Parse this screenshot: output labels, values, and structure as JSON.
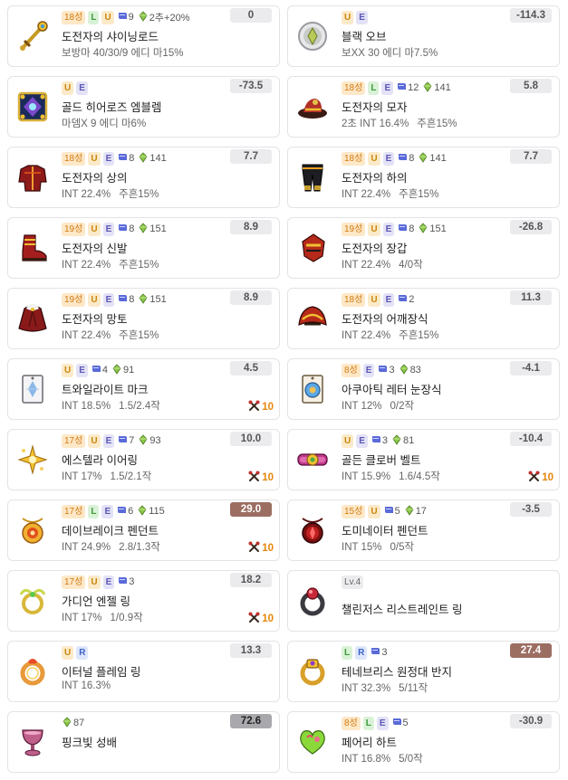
{
  "colors": {
    "star_bg": "#fde8c8",
    "star_text": "#d27a10",
    "L": "#3f9a3a",
    "U": "#c9860a",
    "E": "#5b56b6",
    "R": "#3d63c8",
    "score_bg": "#ebebee",
    "score_brown": "#9c6e62",
    "score_gray": "#a9a9ad",
    "lucky": "#e6860a"
  },
  "items": [
    {
      "col": 0,
      "row": 0,
      "icon": "shining-rod-icon",
      "star": "18성",
      "L": "L",
      "U": "U",
      "scroll": "9",
      "gem": "2추+20%",
      "name": "도전자의 샤이닝로드",
      "stats": [
        "보방마 40/30/9 에디 마15%"
      ],
      "score": "0",
      "hl": ""
    },
    {
      "col": 1,
      "row": 0,
      "icon": "black-orb-icon",
      "U": "U",
      "E": "E",
      "name": "블랙 오브",
      "stats": [
        "보XX 30 에디 마7.5%"
      ],
      "score": "-114.3",
      "hl": ""
    },
    {
      "col": 0,
      "row": 1,
      "icon": "gold-emblem-icon",
      "U": "U",
      "E": "E",
      "name": "골드 히어로즈 엠블렘",
      "stats": [
        "마뎀X 9 에디 마6%"
      ],
      "score": "-73.5",
      "hl": ""
    },
    {
      "col": 1,
      "row": 1,
      "icon": "hat-icon",
      "star": "18성",
      "L": "L",
      "E": "E",
      "scroll": "12",
      "gem": "141",
      "name": "도전자의 모자",
      "stats": [
        "2초 INT 16.4%",
        "주흔15%"
      ],
      "score": "5.8",
      "hl": ""
    },
    {
      "col": 0,
      "row": 2,
      "icon": "top-icon",
      "star": "18성",
      "U": "U",
      "E": "E",
      "scroll": "8",
      "gem": "141",
      "name": "도전자의 상의",
      "stats": [
        "INT 22.4%",
        "주흔15%"
      ],
      "score": "7.7",
      "hl": ""
    },
    {
      "col": 1,
      "row": 2,
      "icon": "bottom-icon",
      "star": "18성",
      "U": "U",
      "E": "E",
      "scroll": "8",
      "gem": "141",
      "name": "도전자의 하의",
      "stats": [
        "INT 22.4%",
        "주흔15%"
      ],
      "score": "7.7",
      "hl": ""
    },
    {
      "col": 0,
      "row": 3,
      "icon": "shoes-icon",
      "star": "19성",
      "U": "U",
      "E": "E",
      "scroll": "8",
      "gem": "151",
      "name": "도전자의 신발",
      "stats": [
        "INT 22.4%",
        "주흔15%"
      ],
      "score": "8.9",
      "hl": ""
    },
    {
      "col": 1,
      "row": 3,
      "icon": "glove-icon",
      "star": "19성",
      "U": "U",
      "E": "E",
      "scroll": "8",
      "gem": "151",
      "name": "도전자의 장갑",
      "stats": [
        "INT 22.4%",
        "4/0작"
      ],
      "score": "-26.8",
      "hl": ""
    },
    {
      "col": 0,
      "row": 4,
      "icon": "cape-icon",
      "star": "19성",
      "U": "U",
      "E": "E",
      "scroll": "8",
      "gem": "151",
      "name": "도전자의 망토",
      "stats": [
        "INT 22.4%",
        "주흔15%"
      ],
      "score": "8.9",
      "hl": ""
    },
    {
      "col": 1,
      "row": 4,
      "icon": "shoulder-icon",
      "star": "18성",
      "U": "U",
      "E": "E",
      "scroll": "2",
      "name": "도전자의 어깨장식",
      "stats": [
        "INT 22.4%",
        "주흔15%"
      ],
      "score": "11.3",
      "hl": ""
    },
    {
      "col": 0,
      "row": 5,
      "icon": "twilight-mark-icon",
      "U": "U",
      "E": "E",
      "scroll": "4",
      "gem": "91",
      "name": "트와일라이트 마크",
      "stats": [
        "INT 18.5%",
        "1.5/2.4작"
      ],
      "score": "4.5",
      "lucky": "10",
      "hl": ""
    },
    {
      "col": 1,
      "row": 5,
      "icon": "aquatic-eye-icon",
      "star": "8성",
      "E": "E",
      "scroll": "3",
      "gem": "83",
      "name": "아쿠아틱 레터 눈장식",
      "stats": [
        "INT 12%",
        "0/2작"
      ],
      "score": "-4.1",
      "hl": ""
    },
    {
      "col": 0,
      "row": 6,
      "icon": "estella-earring-icon",
      "star": "17성",
      "U": "U",
      "E": "E",
      "scroll": "7",
      "gem": "93",
      "name": "에스텔라 이어링",
      "stats": [
        "INT 17%",
        "1.5/2.1작"
      ],
      "score": "10.0",
      "lucky": "10",
      "hl": ""
    },
    {
      "col": 1,
      "row": 6,
      "icon": "clover-belt-icon",
      "U": "U",
      "E": "E",
      "scroll": "3",
      "gem": "81",
      "name": "골든 클로버 벨트",
      "stats": [
        "INT 15.9%",
        "1.6/4.5작"
      ],
      "score": "-10.4",
      "lucky": "10",
      "hl": ""
    },
    {
      "col": 0,
      "row": 7,
      "icon": "daybreak-pendant-icon",
      "star": "17성",
      "L": "L",
      "E": "E",
      "scroll": "6",
      "gem": "115",
      "name": "데이브레이크 펜던트",
      "stats": [
        "INT 24.9%",
        "2.8/1.3작"
      ],
      "score": "29.0",
      "lucky": "10",
      "hl": "brown"
    },
    {
      "col": 1,
      "row": 7,
      "icon": "dominator-pendant-icon",
      "star": "15성",
      "U": "U",
      "scroll": "5",
      "gem": "17",
      "name": "도미네이터 펜던트",
      "stats": [
        "INT 15%",
        "0/5작"
      ],
      "score": "-3.5",
      "hl": ""
    },
    {
      "col": 0,
      "row": 8,
      "icon": "angel-ring-icon",
      "star": "17성",
      "U": "U",
      "E": "E",
      "scroll": "3",
      "name": "가디언 엔젤 링",
      "stats": [
        "INT 17%",
        "1/0.9작"
      ],
      "score": "18.2",
      "lucky": "10",
      "hl": ""
    },
    {
      "col": 1,
      "row": 8,
      "icon": "restraint-ring-icon",
      "lv": "Lv.4",
      "name": "챌린저스 리스트레인트 링",
      "stats": [],
      "score": "",
      "hl": ""
    },
    {
      "col": 0,
      "row": 9,
      "icon": "eternal-ring-icon",
      "U": "U",
      "R": "R",
      "name": "이터널 플레임 링",
      "stats": [
        "INT 16.3%"
      ],
      "score": "13.3",
      "hl": ""
    },
    {
      "col": 1,
      "row": 9,
      "icon": "tenebris-ring-icon",
      "L": "L",
      "R": "R",
      "scroll": "3",
      "name": "테네브리스 원정대 반지",
      "stats": [
        "INT 32.3%",
        "5/11작"
      ],
      "score": "27.4",
      "hl": "brown"
    },
    {
      "col": 0,
      "row": 10,
      "icon": "pink-chalice-icon",
      "gem": "87",
      "name": "핑크빛 성배",
      "stats": [],
      "score": "72.6",
      "hl": "gray"
    },
    {
      "col": 1,
      "row": 10,
      "icon": "fairy-heart-icon",
      "star": "8성",
      "L": "L",
      "E": "E",
      "scroll": "5",
      "name": "페어리 하트",
      "stats": [
        "INT 16.8%",
        "5/0작"
      ],
      "score": "-30.9",
      "hl": ""
    }
  ]
}
